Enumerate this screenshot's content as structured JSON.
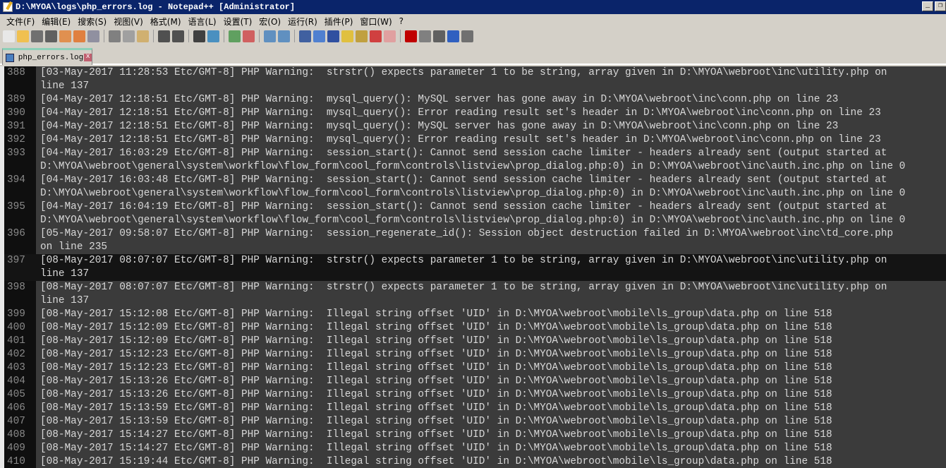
{
  "window": {
    "title": "D:\\MYOA\\logs\\php_errors.log - Notepad++ [Administrator]",
    "minimize": "_",
    "restore": "❐"
  },
  "menu": [
    "文件(F)",
    "编辑(E)",
    "搜索(S)",
    "视图(V)",
    "格式(M)",
    "语言(L)",
    "设置(T)",
    "宏(O)",
    "运行(R)",
    "插件(P)",
    "窗口(W)",
    "?"
  ],
  "toolbar": [
    {
      "name": "new-file-icon",
      "color": "#e8e8e8"
    },
    {
      "name": "open-file-icon",
      "color": "#f0c050"
    },
    {
      "name": "save-icon",
      "color": "#707070"
    },
    {
      "name": "save-all-icon",
      "color": "#606060"
    },
    {
      "name": "close-icon",
      "color": "#e09050"
    },
    {
      "name": "close-all-icon",
      "color": "#e08040"
    },
    {
      "name": "print-icon",
      "color": "#9090a0"
    },
    "sep",
    {
      "name": "cut-icon",
      "color": "#808080"
    },
    {
      "name": "copy-icon",
      "color": "#a0a0a0"
    },
    {
      "name": "paste-icon",
      "color": "#d0b070"
    },
    "sep",
    {
      "name": "undo-icon",
      "color": "#505050"
    },
    {
      "name": "redo-icon",
      "color": "#505050"
    },
    "sep",
    {
      "name": "find-icon",
      "color": "#404040"
    },
    {
      "name": "replace-icon",
      "color": "#4a90c0"
    },
    "sep",
    {
      "name": "zoom-in-icon",
      "color": "#60a060"
    },
    {
      "name": "zoom-out-icon",
      "color": "#d06060"
    },
    "sep",
    {
      "name": "sync-vertical-icon",
      "color": "#6090c0"
    },
    {
      "name": "sync-horizontal-icon",
      "color": "#6090c0"
    },
    "sep",
    {
      "name": "word-wrap-icon",
      "color": "#4060a0"
    },
    {
      "name": "show-all-chars-icon",
      "color": "#5080d0"
    },
    {
      "name": "indent-guide-icon",
      "color": "#3050a0"
    },
    {
      "name": "user-language-icon",
      "color": "#e0c040"
    },
    {
      "name": "doc-map-icon",
      "color": "#c0a040"
    },
    {
      "name": "function-list-icon",
      "color": "#d04040"
    },
    {
      "name": "folder-workspace-icon",
      "color": "#e0a0a0"
    },
    "sep",
    {
      "name": "record-macro-icon",
      "color": "#c00000"
    },
    {
      "name": "stop-macro-icon",
      "color": "#808080"
    },
    {
      "name": "play-macro-icon",
      "color": "#606060"
    },
    {
      "name": "run-macro-multiple-icon",
      "color": "#3060c0"
    },
    {
      "name": "save-macro-icon",
      "color": "#707070"
    }
  ],
  "tab": {
    "label": "php_errors.log",
    "close": "x"
  },
  "editor": {
    "current_line": 397,
    "entries": [
      {
        "n": "388",
        "parts": [
          "[03-May-2017 11:28:53 Etc/GMT-8] PHP Warning:  strstr() expects parameter 1 to be string, array given in D:\\MYOA\\webroot\\inc\\utility.php on",
          "line 137"
        ]
      },
      {
        "n": "389",
        "parts": [
          "[04-May-2017 12:18:51 Etc/GMT-8] PHP Warning:  mysql_query(): MySQL server has gone away in D:\\MYOA\\webroot\\inc\\conn.php on line 23"
        ]
      },
      {
        "n": "390",
        "parts": [
          "[04-May-2017 12:18:51 Etc/GMT-8] PHP Warning:  mysql_query(): Error reading result set's header in D:\\MYOA\\webroot\\inc\\conn.php on line 23"
        ]
      },
      {
        "n": "391",
        "parts": [
          "[04-May-2017 12:18:51 Etc/GMT-8] PHP Warning:  mysql_query(): MySQL server has gone away in D:\\MYOA\\webroot\\inc\\conn.php on line 23"
        ]
      },
      {
        "n": "392",
        "parts": [
          "[04-May-2017 12:18:51 Etc/GMT-8] PHP Warning:  mysql_query(): Error reading result set's header in D:\\MYOA\\webroot\\inc\\conn.php on line 23"
        ]
      },
      {
        "n": "393",
        "parts": [
          "[04-May-2017 16:03:29 Etc/GMT-8] PHP Warning:  session_start(): Cannot send session cache limiter - headers already sent (output started at",
          "D:\\MYOA\\webroot\\general\\system\\workflow\\flow_form\\cool_form\\controls\\listview\\prop_dialog.php:0) in D:\\MYOA\\webroot\\inc\\auth.inc.php on line 0"
        ]
      },
      {
        "n": "394",
        "parts": [
          "[04-May-2017 16:03:48 Etc/GMT-8] PHP Warning:  session_start(): Cannot send session cache limiter - headers already sent (output started at",
          "D:\\MYOA\\webroot\\general\\system\\workflow\\flow_form\\cool_form\\controls\\listview\\prop_dialog.php:0) in D:\\MYOA\\webroot\\inc\\auth.inc.php on line 0"
        ]
      },
      {
        "n": "395",
        "parts": [
          "[04-May-2017 16:04:19 Etc/GMT-8] PHP Warning:  session_start(): Cannot send session cache limiter - headers already sent (output started at",
          "D:\\MYOA\\webroot\\general\\system\\workflow\\flow_form\\cool_form\\controls\\listview\\prop_dialog.php:0) in D:\\MYOA\\webroot\\inc\\auth.inc.php on line 0"
        ]
      },
      {
        "n": "396",
        "parts": [
          "[05-May-2017 09:58:07 Etc/GMT-8] PHP Warning:  session_regenerate_id(): Session object destruction failed in D:\\MYOA\\webroot\\inc\\td_core.php",
          "on line 235"
        ]
      },
      {
        "n": "397",
        "parts": [
          "[08-May-2017 08:07:07 Etc/GMT-8] PHP Warning:  strstr() expects parameter 1 to be string, array given in D:\\MYOA\\webroot\\inc\\utility.php on",
          "line 137"
        ]
      },
      {
        "n": "398",
        "parts": [
          "[08-May-2017 08:07:07 Etc/GMT-8] PHP Warning:  strstr() expects parameter 1 to be string, array given in D:\\MYOA\\webroot\\inc\\utility.php on",
          "line 137"
        ]
      },
      {
        "n": "399",
        "parts": [
          "[08-May-2017 15:12:08 Etc/GMT-8] PHP Warning:  Illegal string offset 'UID' in D:\\MYOA\\webroot\\mobile\\ls_group\\data.php on line 518"
        ]
      },
      {
        "n": "400",
        "parts": [
          "[08-May-2017 15:12:09 Etc/GMT-8] PHP Warning:  Illegal string offset 'UID' in D:\\MYOA\\webroot\\mobile\\ls_group\\data.php on line 518"
        ]
      },
      {
        "n": "401",
        "parts": [
          "[08-May-2017 15:12:09 Etc/GMT-8] PHP Warning:  Illegal string offset 'UID' in D:\\MYOA\\webroot\\mobile\\ls_group\\data.php on line 518"
        ]
      },
      {
        "n": "402",
        "parts": [
          "[08-May-2017 15:12:23 Etc/GMT-8] PHP Warning:  Illegal string offset 'UID' in D:\\MYOA\\webroot\\mobile\\ls_group\\data.php on line 518"
        ]
      },
      {
        "n": "403",
        "parts": [
          "[08-May-2017 15:12:23 Etc/GMT-8] PHP Warning:  Illegal string offset 'UID' in D:\\MYOA\\webroot\\mobile\\ls_group\\data.php on line 518"
        ]
      },
      {
        "n": "404",
        "parts": [
          "[08-May-2017 15:13:26 Etc/GMT-8] PHP Warning:  Illegal string offset 'UID' in D:\\MYOA\\webroot\\mobile\\ls_group\\data.php on line 518"
        ]
      },
      {
        "n": "405",
        "parts": [
          "[08-May-2017 15:13:26 Etc/GMT-8] PHP Warning:  Illegal string offset 'UID' in D:\\MYOA\\webroot\\mobile\\ls_group\\data.php on line 518"
        ]
      },
      {
        "n": "406",
        "parts": [
          "[08-May-2017 15:13:59 Etc/GMT-8] PHP Warning:  Illegal string offset 'UID' in D:\\MYOA\\webroot\\mobile\\ls_group\\data.php on line 518"
        ]
      },
      {
        "n": "407",
        "parts": [
          "[08-May-2017 15:13:59 Etc/GMT-8] PHP Warning:  Illegal string offset 'UID' in D:\\MYOA\\webroot\\mobile\\ls_group\\data.php on line 518"
        ]
      },
      {
        "n": "408",
        "parts": [
          "[08-May-2017 15:14:27 Etc/GMT-8] PHP Warning:  Illegal string offset 'UID' in D:\\MYOA\\webroot\\mobile\\ls_group\\data.php on line 518"
        ]
      },
      {
        "n": "409",
        "parts": [
          "[08-May-2017 15:14:27 Etc/GMT-8] PHP Warning:  Illegal string offset 'UID' in D:\\MYOA\\webroot\\mobile\\ls_group\\data.php on line 518"
        ]
      },
      {
        "n": "410",
        "parts": [
          "[08-May-2017 15:19:44 Etc/GMT-8] PHP Warning:  Illegal string offset 'UID' in D:\\MYOA\\webroot\\mobile\\ls_group\\data.php on line 518"
        ]
      }
    ]
  }
}
